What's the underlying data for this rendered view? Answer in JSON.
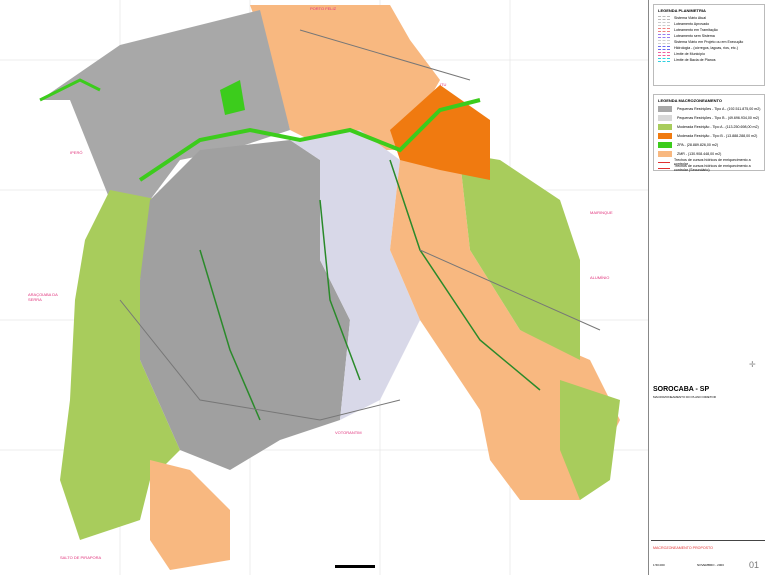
{
  "legend_planimetria": {
    "title": "LEGENDA PLANIMETRIA",
    "items": [
      {
        "label": "Sistema Viário Atual",
        "color": "#bbbbbb"
      },
      {
        "label": "Loteamento Aprovado",
        "color": "#cccccc"
      },
      {
        "label": "Loteamento em Tramitação",
        "color": "#f08080"
      },
      {
        "label": "Loteamento sem Sistema",
        "color": "#9a7cf0"
      },
      {
        "label": "Sistema Viário em Projeto ou em Execução",
        "color": "#d0d0d0"
      },
      {
        "label": "Hidrologia - (córregos, lagoas, rios, etc.)",
        "color": "#6a6af0"
      },
      {
        "label": "Limite de Município",
        "color": "#f060a0"
      },
      {
        "label": "Limite de Bacia de Planos",
        "color": "#30d0e0"
      }
    ]
  },
  "legend_macro": {
    "title": "LEGENDA MACROZONEAMENTO",
    "items": [
      {
        "label": "Pequenas Restrições - Tipo A - (192.511.875,00 m2)",
        "color": "#a8a8a8"
      },
      {
        "label": "Pequenas Restrições - Tipo B - (49.696.934,00 m2)",
        "color": "#d8d8d8"
      },
      {
        "label": "Moderada Restrição - Tipo A - (113.250.698,00 m2)",
        "color": "#a8cc5c"
      },
      {
        "label": "Moderada Restrição - Tipo B - (13.888.288,00 m2)",
        "color": "#f07a10"
      },
      {
        "label": "ZPA - (28.889.826,00 m2)",
        "color": "#3ccc1c"
      },
      {
        "label": "ZMR - (130.908.448,00 m2)",
        "color": "#f8b880"
      }
    ],
    "lines": [
      {
        "label": "Trechos de cursos hídricos de enriquecimento a controlar",
        "color": "#e03030"
      },
      {
        "label": "Trechos de cursos hídricos de enriquecimento a controlar (Secundário)",
        "color": "#e03030"
      }
    ]
  },
  "title": {
    "city": "SOROCABA - SP",
    "subtitle": "MACROZONEAMENTO DO PLANO DIRETOR"
  },
  "footer": {
    "plan": "MACROZONEAMENTO PROPOSTO",
    "scale": "1:50.000",
    "date": "NOVEMBRO - 2003",
    "sheet": "01"
  },
  "neighbors": [
    "PORTO FELIZ",
    "ITU",
    "IPERÓ",
    "ARAÇOIABA DA SERRA",
    "SALTO DE PIRAPORA",
    "VOTORANTIM",
    "ALUMÍNIO",
    "MAIRINQUE"
  ]
}
